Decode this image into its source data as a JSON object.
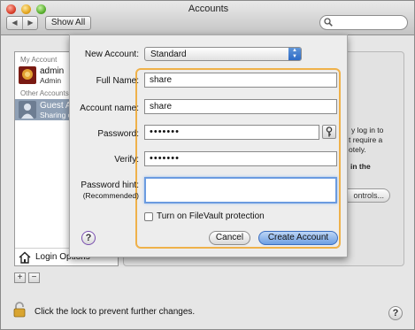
{
  "window": {
    "title": "Accounts"
  },
  "toolbar": {
    "back_glyph": "◀",
    "forward_glyph": "▶",
    "show_all_label": "Show All",
    "search_placeholder": ""
  },
  "sidebar": {
    "my_account_header": "My Account",
    "my_account": {
      "name": "admin",
      "role": "Admin"
    },
    "other_accounts_header": "Other Accounts",
    "guest": {
      "name": "Guest Account",
      "status": "Sharing only"
    },
    "login_options_label": "Login Options",
    "add_label": "+",
    "remove_label": "−"
  },
  "background_panel": {
    "line1": "y log in to",
    "line2": "t require a",
    "line3": "otely.",
    "line4": "in the",
    "button_label": "ontrols..."
  },
  "footer": {
    "lock_text": "Click the lock to prevent further changes.",
    "help_label": "?"
  },
  "sheet": {
    "new_account_label": "New Account:",
    "account_type": "Standard",
    "full_name_label": "Full Name:",
    "full_name_value": "share",
    "account_name_label": "Account name:",
    "account_name_value": "share",
    "password_label": "Password:",
    "password_value": "•••••••",
    "verify_label": "Verify:",
    "verify_value": "•••••••",
    "hint_label": "Password hint:",
    "hint_sublabel": "(Recommended)",
    "hint_value": "",
    "filevault_label": "Turn on FileVault protection",
    "filevault_checked": false,
    "help_label": "?",
    "cancel_label": "Cancel",
    "create_label": "Create Account"
  },
  "colors": {
    "focus_ring": "#efb14a",
    "default_button": "#6e9fe3",
    "selection": "#8fa0b5"
  }
}
